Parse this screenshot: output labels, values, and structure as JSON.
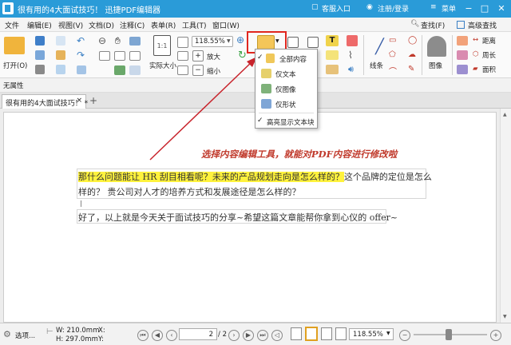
{
  "window": {
    "title": "很有用的4大面试技巧！ 迅捷PDF编辑器",
    "service": "客服入口",
    "login": "注册/登录",
    "menu": "菜单",
    "min": "−",
    "max": "□",
    "close": "✕"
  },
  "menubar": {
    "items": [
      "文件",
      "编辑(E)",
      "视图(V)",
      "文档(D)",
      "注释(C)",
      "表单(R)",
      "工具(T)",
      "窗口(W)"
    ],
    "find": "查找(F)",
    "adv_find": "高级查找"
  },
  "ribbon": {
    "open": "打开(O)",
    "actual_size": "实际大小",
    "zoom": "118.55%",
    "zoom_in": "放大",
    "zoom_out": "缩小",
    "lines": "线条",
    "image": "图像",
    "distance": "距离",
    "perimeter": "周长",
    "area": "面积"
  },
  "props": {
    "label": "无属性"
  },
  "tab": {
    "label": "很有用的4大面试技巧！ *",
    "close": "×",
    "add": "+"
  },
  "dropdown": {
    "items": [
      {
        "label": "全部内容",
        "checked": true
      },
      {
        "label": "仅文本",
        "checked": false
      },
      {
        "label": "仅图像",
        "checked": false
      },
      {
        "label": "仅形状",
        "checked": false
      }
    ],
    "highlight": "高亮显示文本块"
  },
  "annotation": "选择内容编辑工具，就能对PDF内容进行修改啦",
  "doc": {
    "line1_hl": "那什么问题能让 HR 刮目相看呢？未来的产品规划走向是怎么样的？",
    "line1_rest": "这个品牌的定位是怎么",
    "line2": "样的？ 贵公司对人才的培养方式和发展途径是怎么样的？",
    "line3": "好了，以上就是今天关于面试技巧的分享~希望这篇文章能帮你拿到心仪的 offer~"
  },
  "status": {
    "options": "选项...",
    "w": "W: 210.0mm",
    "h": "H: 297.0mm",
    "x": "X:",
    "y": "Y:",
    "page": "2",
    "page_total": "/ 2",
    "zoom": "118.55%"
  },
  "colors": {
    "title_bg": "#2a9bd8",
    "arrow": "#c8242c",
    "highlight": "#fff23d"
  }
}
